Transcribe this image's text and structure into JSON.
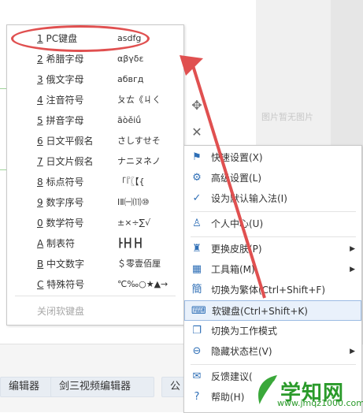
{
  "background": {
    "no_image_text": "图片暂无图片",
    "chips": [
      "编辑器",
      "剑三视频编辑器",
      "公"
    ]
  },
  "keyboard_menu": {
    "items": [
      {
        "num": "1",
        "label": " PC键盘",
        "sample": "asdfg"
      },
      {
        "num": "2",
        "label": " 希腊字母",
        "sample": "αβγδε"
      },
      {
        "num": "3",
        "label": " 俄文字母",
        "sample": "абвгд"
      },
      {
        "num": "4",
        "label": " 注音符号",
        "sample": "ㄆㄊ《ㄐㄑ"
      },
      {
        "num": "5",
        "label": " 拼音字母",
        "sample": "āòěiǘ"
      },
      {
        "num": "6",
        "label": " 日文平假名",
        "sample": "さしすせそ"
      },
      {
        "num": "7",
        "label": " 日文片假名",
        "sample": "ナニヌネノ"
      },
      {
        "num": "8",
        "label": " 标点符号",
        "sample": "「『〖【{"
      },
      {
        "num": "9",
        "label": " 数字序号",
        "sample": "ⅠⅡ㈠⑾⑩"
      },
      {
        "num": "0",
        "label": " 数学符号",
        "sample": "±×÷∑√"
      },
      {
        "num": "A",
        "label": " 制表符",
        "sample": "┣┣┫┣┫"
      },
      {
        "num": "B",
        "label": " 中文数字",
        "sample": "＄零壹佰厘"
      },
      {
        "num": "C",
        "label": " 特殊符号",
        "sample": "℃‰○★▲→"
      }
    ],
    "close_label": "关闭软键盘"
  },
  "main_menu": {
    "items": [
      {
        "icon": "flag-icon",
        "glyph": "⚑",
        "label": "快速设置(X)",
        "arrow": ""
      },
      {
        "icon": "gear-icon",
        "glyph": "⚙",
        "label": "高级设置(L)",
        "arrow": ""
      },
      {
        "icon": "check-circle-icon",
        "glyph": "✓",
        "label": "设为默认输入法(I)",
        "arrow": ""
      },
      {
        "icon": "user-icon",
        "glyph": "♙",
        "label": "个人中心(U)",
        "arrow": ""
      },
      {
        "icon": "shirt-icon",
        "glyph": "♜",
        "label": "更换皮肤(P)",
        "arrow": "▶"
      },
      {
        "icon": "grid-icon",
        "glyph": "▦",
        "label": "工具箱(M)",
        "arrow": "▶"
      },
      {
        "icon": "traditional-char-icon",
        "glyph": "簡",
        "label": "切换为繁体(Ctrl+Shift+F)",
        "arrow": ""
      },
      {
        "icon": "keyboard-icon",
        "glyph": "⌨",
        "label": "软键盘(Ctrl+Shift+K)",
        "arrow": ""
      },
      {
        "icon": "copy-icon",
        "glyph": "❐",
        "label": "切换为工作模式",
        "arrow": ""
      },
      {
        "icon": "minus-circle-icon",
        "glyph": "⊖",
        "label": "隐藏状态栏(V)",
        "arrow": "▶"
      },
      {
        "icon": "feedback-icon",
        "glyph": "✉",
        "label": "反馈建议(",
        "arrow": ""
      },
      {
        "icon": "help-icon",
        "glyph": "?",
        "label": "帮助(H)",
        "arrow": ""
      }
    ]
  },
  "watermark": {
    "title": "学知网",
    "url": "www.jmqz1000.com"
  },
  "colors": {
    "accent": "#2f6fb6",
    "highlight_bg": "#e9f1fb",
    "annotation_red": "#e05050",
    "watermark_green": "#2a9a2a"
  }
}
